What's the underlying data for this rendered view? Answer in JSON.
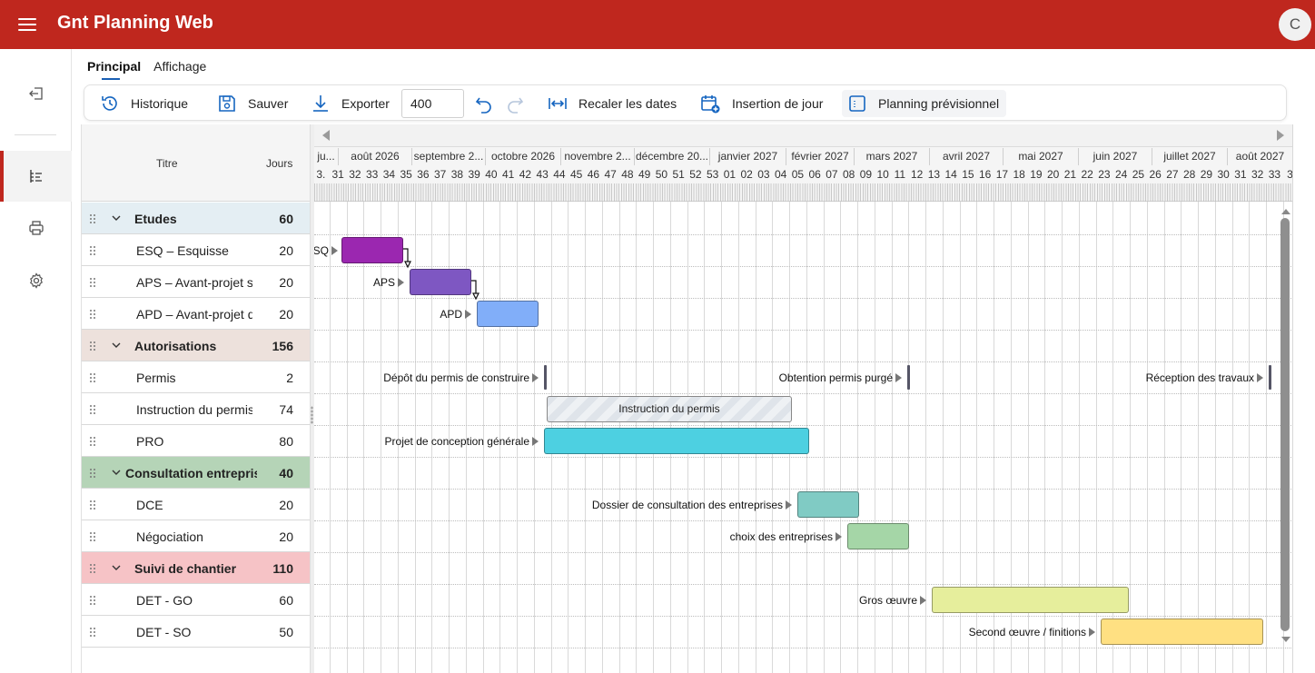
{
  "app": {
    "title": "Gnt Planning Web",
    "avatar": "C"
  },
  "rail": {
    "items": [
      "logout-icon",
      "gantt-tree-icon",
      "print-icon",
      "settings-icon"
    ],
    "active": "gantt-tree-icon"
  },
  "tabs": [
    {
      "label": "Principal",
      "active": true
    },
    {
      "label": "Affichage",
      "active": false
    }
  ],
  "toolbar": {
    "history": "Historique",
    "save": "Sauver",
    "export": "Exporter",
    "zoom": "400",
    "recalc": "Recaler les dates",
    "insert_day": "Insertion de jour",
    "forecast": "Planning prévisionnel"
  },
  "grid": {
    "col_title": "Titre",
    "col_days": "Jours",
    "rows": [
      {
        "kind": "group",
        "name": "Etudes",
        "days": "60",
        "color": "#e4eef3"
      },
      {
        "kind": "task",
        "name": "ESQ – Esquisse",
        "days": "20"
      },
      {
        "kind": "task",
        "name": "APS – Avant-projet sommaire",
        "days": "20"
      },
      {
        "kind": "task",
        "name": "APD – Avant-projet détaillé",
        "days": "20"
      },
      {
        "kind": "group",
        "name": "Autorisations",
        "days": "156",
        "color": "#ede1dc"
      },
      {
        "kind": "task",
        "name": "Permis",
        "days": "2"
      },
      {
        "kind": "task",
        "name": "Instruction du permis",
        "days": "74"
      },
      {
        "kind": "task",
        "name": "PRO",
        "days": "80"
      },
      {
        "kind": "group",
        "name": "Consultation entreprises",
        "days": "40",
        "color": "#b5d4b7"
      },
      {
        "kind": "task",
        "name": "DCE",
        "days": "20"
      },
      {
        "kind": "task",
        "name": "Négociation",
        "days": "20"
      },
      {
        "kind": "group",
        "name": "Suivi de chantier",
        "days": "110",
        "color": "#f6c3c6"
      },
      {
        "kind": "task",
        "name": "DET - GO",
        "days": "60"
      },
      {
        "kind": "task",
        "name": "DET - SO",
        "days": "50"
      }
    ]
  },
  "timeline": {
    "months": [
      "ju...",
      "août 2026",
      "septembre 2...",
      "octobre 2026",
      "novembre 2...",
      "décembre 20...",
      "janvier 2027",
      "février 2027",
      "mars 2027",
      "avril 2027",
      "mai 2027",
      "juin 2027",
      "juillet 2027",
      "août 2027"
    ],
    "weeks": [
      "3.",
      "31",
      "32",
      "33",
      "34",
      "35",
      "36",
      "37",
      "38",
      "39",
      "40",
      "41",
      "42",
      "43",
      "44",
      "45",
      "46",
      "47",
      "48",
      "49",
      "50",
      "51",
      "52",
      "53",
      "01",
      "02",
      "03",
      "04",
      "05",
      "06",
      "07",
      "08",
      "09",
      "10",
      "11",
      "12",
      "13",
      "14",
      "15",
      "16",
      "17",
      "18",
      "19",
      "20",
      "21",
      "22",
      "23",
      "24",
      "25",
      "26",
      "27",
      "28",
      "29",
      "30",
      "31",
      "32",
      "33",
      "3."
    ]
  },
  "bars": [
    {
      "label": "ESQ",
      "color": "#9b27b0"
    },
    {
      "label": "APS",
      "color": "#7e57c2"
    },
    {
      "label": "APD",
      "color": "#81aef9"
    },
    {
      "label": "Dépôt du permis de construire",
      "milestone": true
    },
    {
      "label": "Obtention permis purgé",
      "milestone": true
    },
    {
      "label": "Réception des travaux",
      "milestone": true
    },
    {
      "label": "Instruction du permis",
      "hatched": true
    },
    {
      "label": "Projet de conception générale",
      "color": "#4dd0e1"
    },
    {
      "label": "Dossier de consultation des entreprises",
      "color": "#80cbc4"
    },
    {
      "label": "choix des entreprises",
      "color": "#a5d6a7"
    },
    {
      "label": "Gros œuvre",
      "color": "#e6ee9c"
    },
    {
      "label": "Second œuvre / finitions",
      "color": "#ffe082"
    }
  ]
}
